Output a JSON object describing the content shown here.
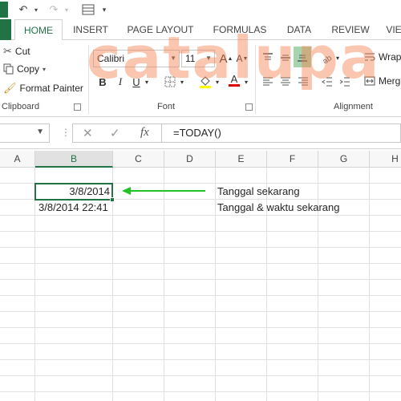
{
  "watermark": "catalupa",
  "ribbon": {
    "tabs": [
      "HOME",
      "INSERT",
      "PAGE LAYOUT",
      "FORMULAS",
      "DATA",
      "REVIEW",
      "VIE"
    ],
    "active_tab": "HOME",
    "clipboard": {
      "cut": "Cut",
      "copy": "Copy",
      "format_painter": "Format Painter",
      "label": "Clipboard"
    },
    "font": {
      "family": "Calibri",
      "size": "11",
      "label": "Font"
    },
    "alignment": {
      "wrap": "Wrap",
      "merge": "Merg",
      "label": "Alignment"
    }
  },
  "formula_bar": {
    "name_box": "",
    "fx": "fx",
    "formula": "=TODAY()"
  },
  "columns": [
    "A",
    "B",
    "C",
    "D",
    "E",
    "F",
    "G",
    "H"
  ],
  "active_column": "B",
  "cells": {
    "b2": "3/8/2014",
    "b3": "3/8/2014 22:41",
    "e2": "Tanggal sekarang",
    "e3": "Tanggal & waktu sekarang"
  },
  "colors": {
    "excel_green": "#217346",
    "arrow_green": "#22c322",
    "watermark": "#f3804e"
  }
}
